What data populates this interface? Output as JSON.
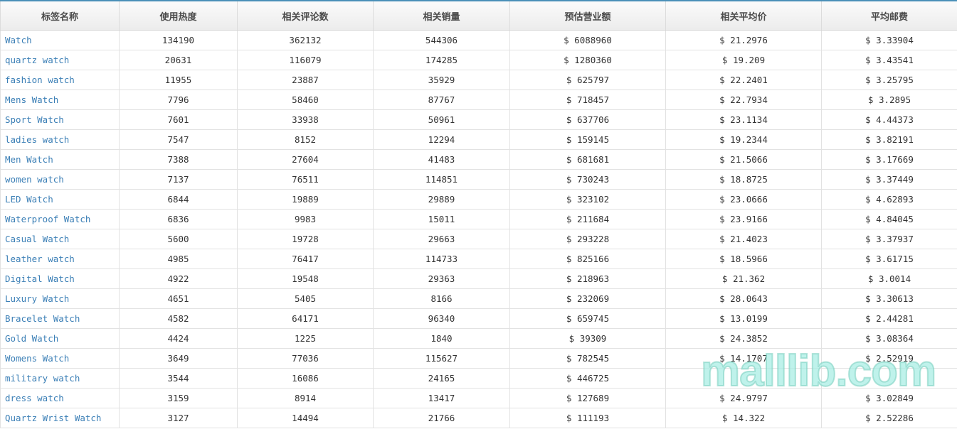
{
  "table": {
    "headers": [
      "标签名称",
      "使用热度",
      "相关评论数",
      "相关销量",
      "预估营业额",
      "相关平均价",
      "平均邮费"
    ],
    "rows": [
      [
        "Watch",
        "134190",
        "362132",
        "544306",
        "$ 6088960",
        "$ 21.2976",
        "$ 3.33904"
      ],
      [
        "quartz watch",
        "20631",
        "116079",
        "174285",
        "$ 1280360",
        "$ 19.209",
        "$ 3.43541"
      ],
      [
        "fashion watch",
        "11955",
        "23887",
        "35929",
        "$ 625797",
        "$ 22.2401",
        "$ 3.25795"
      ],
      [
        "Mens Watch",
        "7796",
        "58460",
        "87767",
        "$ 718457",
        "$ 22.7934",
        "$ 3.2895"
      ],
      [
        "Sport Watch",
        "7601",
        "33938",
        "50961",
        "$ 637706",
        "$ 23.1134",
        "$ 4.44373"
      ],
      [
        "ladies watch",
        "7547",
        "8152",
        "12294",
        "$ 159145",
        "$ 19.2344",
        "$ 3.82191"
      ],
      [
        "Men Watch",
        "7388",
        "27604",
        "41483",
        "$ 681681",
        "$ 21.5066",
        "$ 3.17669"
      ],
      [
        "women watch",
        "7137",
        "76511",
        "114851",
        "$ 730243",
        "$ 18.8725",
        "$ 3.37449"
      ],
      [
        "LED Watch",
        "6844",
        "19889",
        "29889",
        "$ 323102",
        "$ 23.0666",
        "$ 4.62893"
      ],
      [
        "Waterproof Watch",
        "6836",
        "9983",
        "15011",
        "$ 211684",
        "$ 23.9166",
        "$ 4.84045"
      ],
      [
        "Casual Watch",
        "5600",
        "19728",
        "29663",
        "$ 293228",
        "$ 21.4023",
        "$ 3.37937"
      ],
      [
        "leather watch",
        "4985",
        "76417",
        "114733",
        "$ 825166",
        "$ 18.5966",
        "$ 3.61715"
      ],
      [
        "Digital Watch",
        "4922",
        "19548",
        "29363",
        "$ 218963",
        "$ 21.362",
        "$ 3.0014"
      ],
      [
        "Luxury Watch",
        "4651",
        "5405",
        "8166",
        "$ 232069",
        "$ 28.0643",
        "$ 3.30613"
      ],
      [
        "Bracelet Watch",
        "4582",
        "64171",
        "96340",
        "$ 659745",
        "$ 13.0199",
        "$ 2.44281"
      ],
      [
        "Gold Watch",
        "4424",
        "1225",
        "1840",
        "$ 39309",
        "$ 24.3852",
        "$ 3.08364"
      ],
      [
        "Womens Watch",
        "3649",
        "77036",
        "115627",
        "$ 782545",
        "$ 14.1707",
        "$ 2.52919"
      ],
      [
        "military watch",
        "3544",
        "16086",
        "24165",
        "$ 446725",
        "",
        ""
      ],
      [
        "dress watch",
        "3159",
        "8914",
        "13417",
        "$ 127689",
        "$ 24.9797",
        "$ 3.02849"
      ],
      [
        "Quartz Wrist Watch",
        "3127",
        "14494",
        "21766",
        "$ 111193",
        "$ 14.322",
        "$ 2.52286"
      ]
    ]
  },
  "watermark": {
    "text": "malllib.com",
    "color": "#aaeee4"
  },
  "colors": {
    "link": "#3b7fb6",
    "header_top_border": "#4a90b8"
  }
}
